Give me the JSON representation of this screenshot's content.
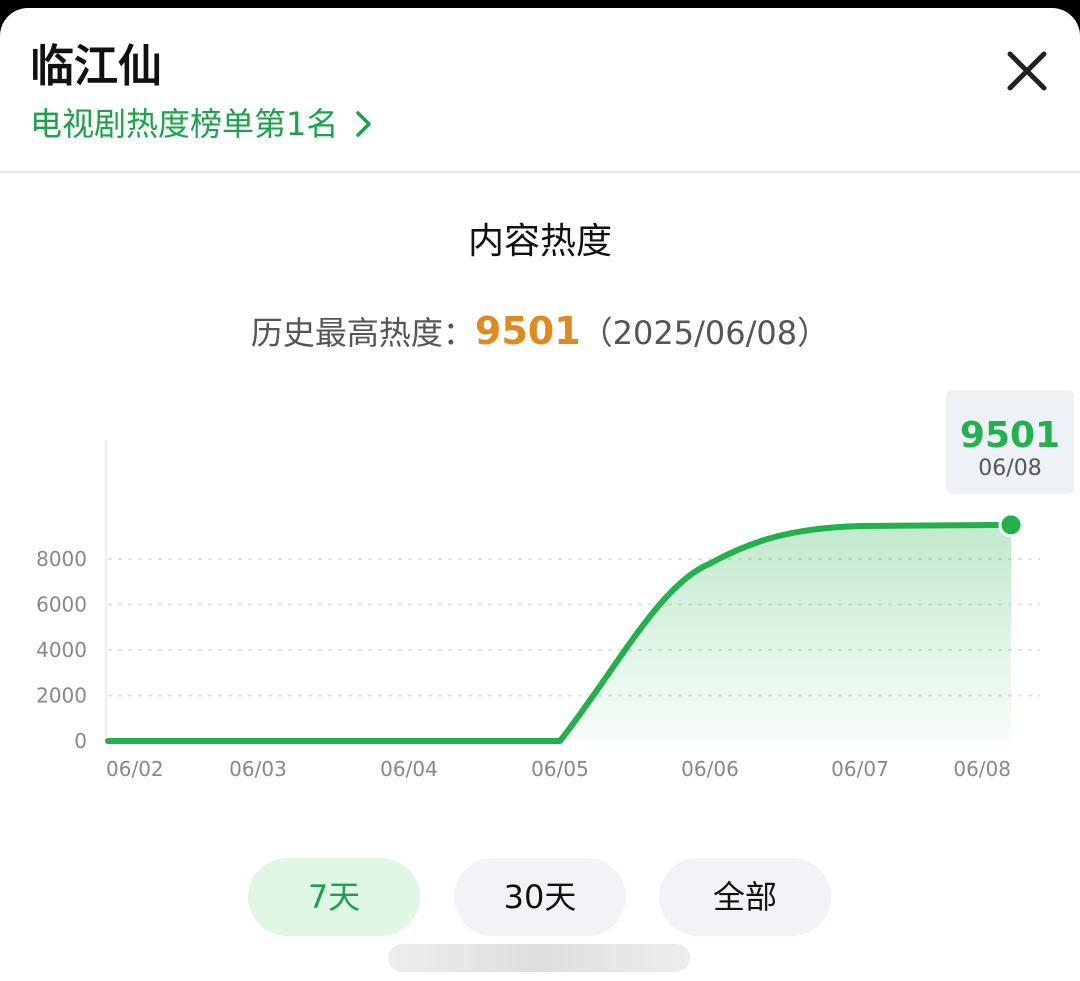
{
  "header": {
    "title": "临江仙",
    "rank_link": "电视剧热度榜单第1名"
  },
  "section_title": "内容热度",
  "record": {
    "label": "历史最高热度：",
    "value": "9501",
    "date": "（2025/06/08）"
  },
  "tooltip": {
    "value": "9501",
    "date": "06/08"
  },
  "tabs": [
    {
      "label": "7天",
      "active": true
    },
    {
      "label": "30天",
      "active": false
    },
    {
      "label": "全部",
      "active": false
    }
  ],
  "colors": {
    "accent": "#22b14c",
    "record_value": "#e08a1e"
  },
  "chart_data": {
    "type": "area",
    "title": "",
    "xlabel": "",
    "ylabel": "",
    "ylim": [
      0,
      8000
    ],
    "y_ticks": [
      "0",
      "2000",
      "4000",
      "6000",
      "8000"
    ],
    "x_ticks": [
      "06/02",
      "06/03",
      "06/04",
      "06/05",
      "06/06",
      "06/07",
      "06/08"
    ],
    "grid": true,
    "series": [
      {
        "values": [
          {
            "x": "06/02",
            "y": 0
          },
          {
            "x": "06/03",
            "y": 0
          },
          {
            "x": "06/04",
            "y": 0
          },
          {
            "x": "06/05",
            "y": 0
          },
          {
            "x": "06/06",
            "y": 7800
          },
          {
            "x": "06/07",
            "y": 9450
          },
          {
            "x": "06/08",
            "y": 9501
          }
        ]
      }
    ],
    "highlight": {
      "x": "06/08",
      "y": 9501
    }
  }
}
